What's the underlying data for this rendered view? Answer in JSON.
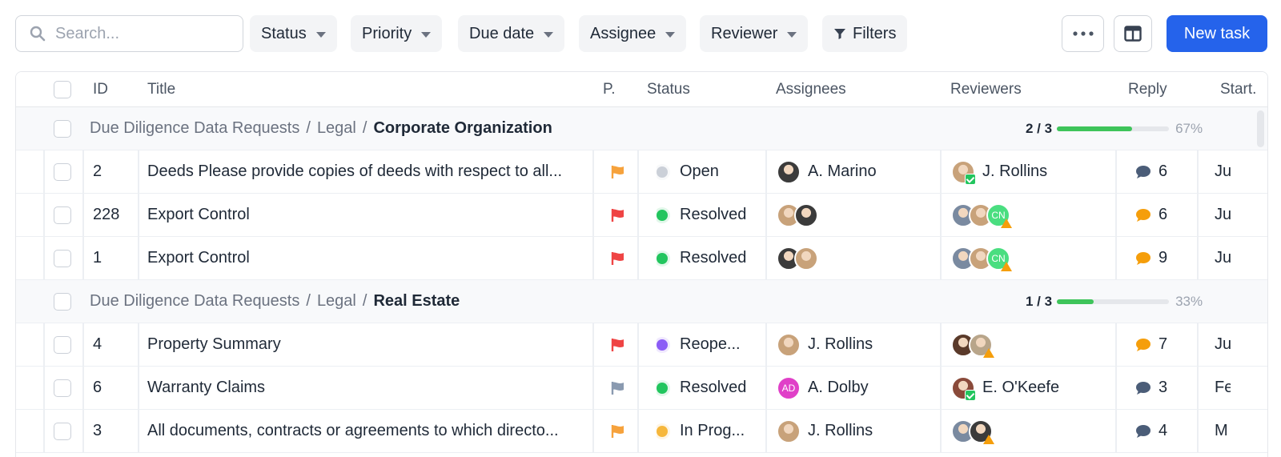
{
  "toolbar": {
    "search_placeholder": "Search...",
    "filters": [
      "Status",
      "Priority",
      "Due date",
      "Assignee",
      "Reviewer"
    ],
    "filters_label": "Filters",
    "more_icon": "ellipsis-icon",
    "layout_icon": "columns-icon",
    "new_task_label": "New task",
    "accent": "#2563eb"
  },
  "table": {
    "columns": {
      "id": "ID",
      "title": "Title",
      "priority": "P.",
      "status": "Status",
      "assignees": "Assignees",
      "reviewers": "Reviewers",
      "reply": "Reply",
      "start": "Start."
    },
    "groups": [
      {
        "path": [
          "Due Diligence Data Requests",
          "Legal"
        ],
        "name": "Corporate Organization",
        "progress_text": "2 / 3",
        "progress": 0.67,
        "percent": "67%",
        "rows": [
          {
            "id": "2",
            "title": "Deeds Please provide copies of deeds with respect to all...",
            "flag": "#f6a23c",
            "status": "Open",
            "status_color": "#cbd0d8",
            "assignees": [
              {
                "type": "photo",
                "color": "#3b3b3b"
              }
            ],
            "assignee_name": "A. Marino",
            "reviewers": [
              {
                "type": "photo",
                "color": "#c8a27a",
                "badge": "ok"
              }
            ],
            "reviewer_name": "J. Rollins",
            "reply_color": "#4b5d78",
            "replies": "6",
            "start": "Ju"
          },
          {
            "id": "228",
            "title": "Export Control",
            "flag": "#ef4444",
            "status": "Resolved",
            "status_color": "#22c55e",
            "assignees": [
              {
                "type": "photo",
                "color": "#c8a27a"
              },
              {
                "type": "photo",
                "color": "#3b3b3b"
              }
            ],
            "assignee_name": "",
            "reviewers": [
              {
                "type": "photo",
                "color": "#7a8aa0"
              },
              {
                "type": "photo",
                "color": "#c8a27a"
              },
              {
                "type": "initials",
                "text": "CN",
                "color": "#4ade80",
                "badge": "warn"
              }
            ],
            "reviewer_name": "",
            "reply_color": "#f59e0b",
            "replies": "6",
            "start": "Ju"
          },
          {
            "id": "1",
            "title": "Export Control",
            "flag": "#ef4444",
            "status": "Resolved",
            "status_color": "#22c55e",
            "assignees": [
              {
                "type": "photo",
                "color": "#3b3b3b"
              },
              {
                "type": "photo",
                "color": "#c8a27a"
              }
            ],
            "assignee_name": "",
            "reviewers": [
              {
                "type": "photo",
                "color": "#7a8aa0"
              },
              {
                "type": "photo",
                "color": "#c8a27a"
              },
              {
                "type": "initials",
                "text": "CN",
                "color": "#4ade80",
                "badge": "warn"
              }
            ],
            "reviewer_name": "",
            "reply_color": "#f59e0b",
            "replies": "9",
            "start": "Ju"
          }
        ]
      },
      {
        "path": [
          "Due Diligence Data Requests",
          "Legal"
        ],
        "name": "Real Estate",
        "progress_text": "1 / 3",
        "progress": 0.33,
        "percent": "33%",
        "rows": [
          {
            "id": "4",
            "title": "Property Summary",
            "flag": "#ef4444",
            "status": "Reope...",
            "status_color": "#8b5cf6",
            "assignees": [
              {
                "type": "photo",
                "color": "#c8a27a"
              }
            ],
            "assignee_name": "J. Rollins",
            "reviewers": [
              {
                "type": "photo",
                "color": "#5a3a2a"
              },
              {
                "type": "photo",
                "color": "#b8a58a",
                "badge": "warn"
              }
            ],
            "reviewer_name": "",
            "reply_color": "#f59e0b",
            "replies": "7",
            "start": "Ju"
          },
          {
            "id": "6",
            "title": "Warranty Claims",
            "flag": "#8a9ab0",
            "status": "Resolved",
            "status_color": "#22c55e",
            "assignees": [
              {
                "type": "initials",
                "text": "AD",
                "color": "#e040c8"
              }
            ],
            "assignee_name": "A. Dolby",
            "reviewers": [
              {
                "type": "photo",
                "color": "#8a4a3a",
                "badge": "ok"
              }
            ],
            "reviewer_name": "E. O'Keefe",
            "reply_color": "#4b5d78",
            "replies": "3",
            "start": "Fe"
          },
          {
            "id": "3",
            "title": "All documents, contracts or agreements to which directo...",
            "flag": "#f6a23c",
            "status": "In Prog...",
            "status_color": "#f6b73c",
            "assignees": [
              {
                "type": "photo",
                "color": "#c8a27a"
              }
            ],
            "assignee_name": "J. Rollins",
            "reviewers": [
              {
                "type": "photo",
                "color": "#7a8aa0"
              },
              {
                "type": "photo",
                "color": "#3b3b3b",
                "badge": "warn"
              }
            ],
            "reviewer_name": "",
            "reply_color": "#4b5d78",
            "replies": "4",
            "start": "M"
          }
        ]
      }
    ]
  }
}
